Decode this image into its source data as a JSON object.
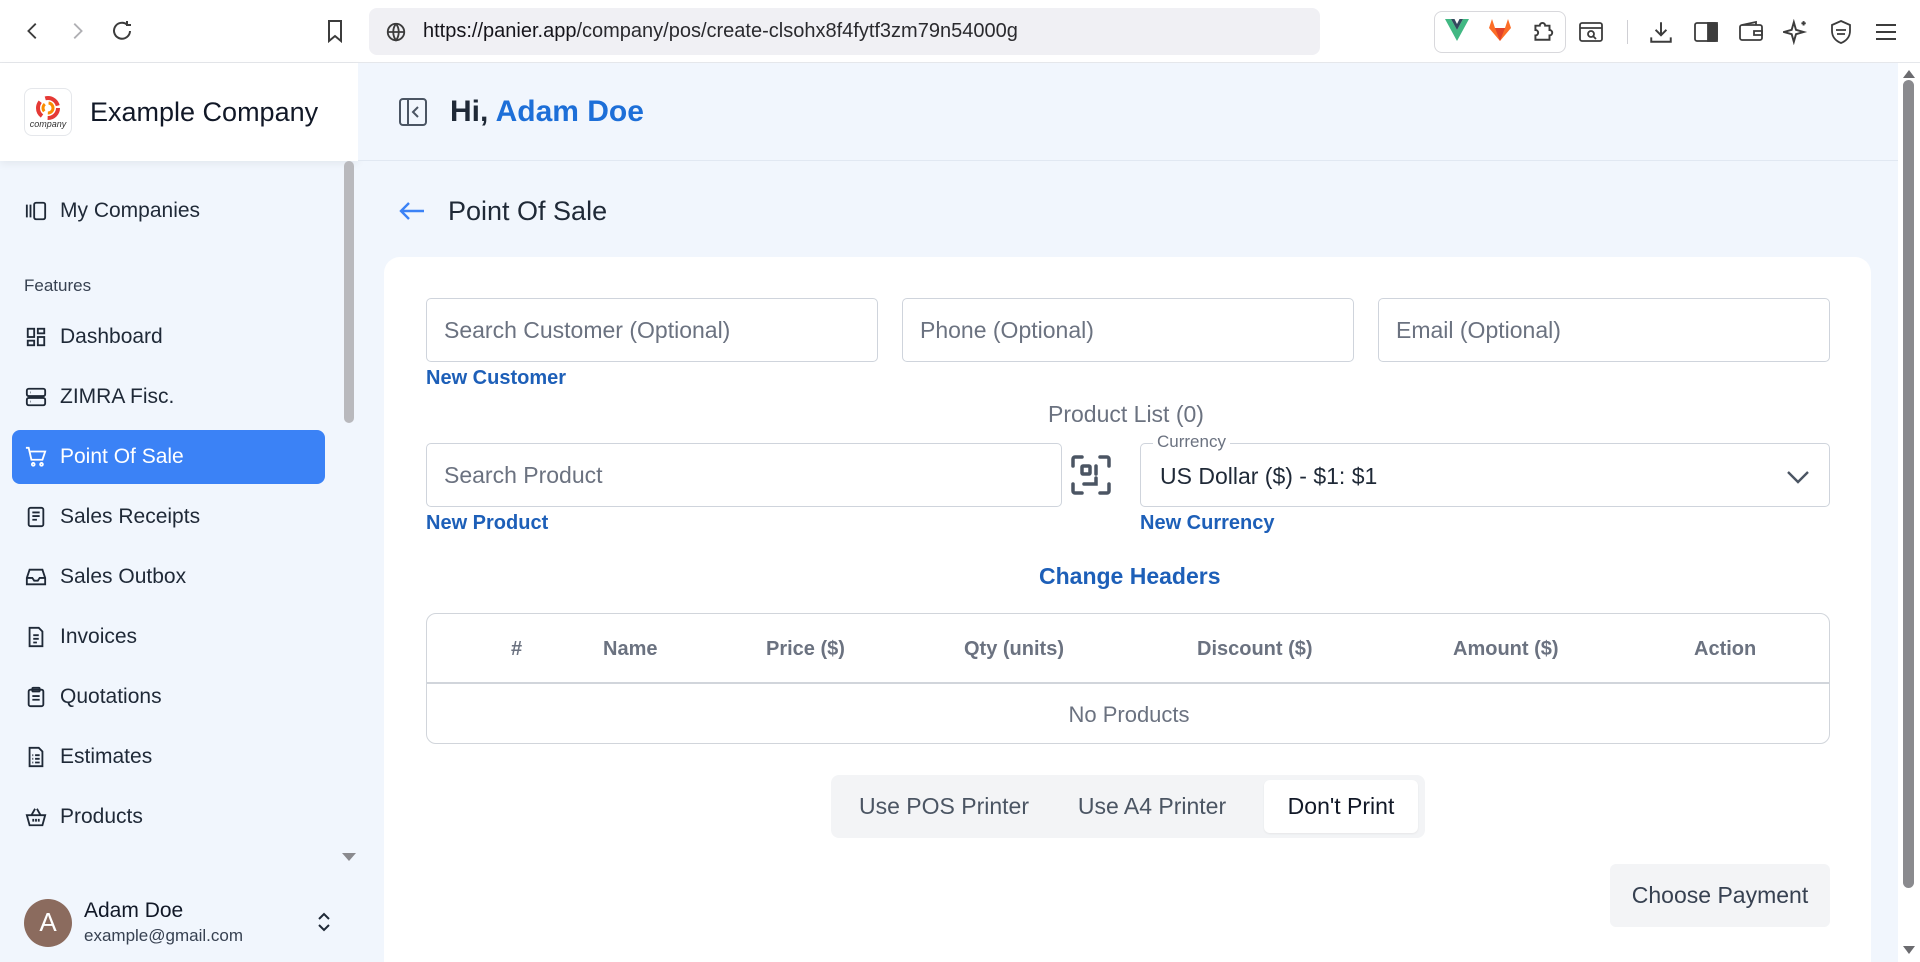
{
  "browser": {
    "url_host": "https://panier.app",
    "url_path": "/company/pos/create-clsohx8f4fytf3zm79n54000g",
    "icons": [
      "back-icon",
      "forward-icon",
      "reload-icon",
      "bookmark-icon",
      "site-info-icon",
      "vue-extension-icon",
      "gitlab-extension-icon",
      "extensions-puzzle-icon",
      "search-page-icon",
      "download-icon",
      "sidebar-icon",
      "wallet-icon",
      "sparkle-icon",
      "shield-icon",
      "menu-icon"
    ]
  },
  "brand": {
    "name": "Example Company",
    "logo_text": "company"
  },
  "sidebar": {
    "top_item": "My Companies",
    "section_label": "Features",
    "items": [
      {
        "label": "Dashboard",
        "icon": "dashboard-icon"
      },
      {
        "label": "ZIMRA Fisc.",
        "icon": "server-icon"
      },
      {
        "label": "Point Of Sale",
        "icon": "cart-icon",
        "active": true
      },
      {
        "label": "Sales Receipts",
        "icon": "receipt-icon"
      },
      {
        "label": "Sales Outbox",
        "icon": "inbox-icon"
      },
      {
        "label": "Invoices",
        "icon": "invoice-icon"
      },
      {
        "label": "Quotations",
        "icon": "clipboard-icon"
      },
      {
        "label": "Estimates",
        "icon": "list-doc-icon"
      },
      {
        "label": "Products",
        "icon": "basket-icon"
      }
    ]
  },
  "user": {
    "initial": "A",
    "name": "Adam Doe",
    "email": "example@gmail.com"
  },
  "header": {
    "greeting": "Hi,",
    "user_name": "Adam Doe"
  },
  "page": {
    "title": "Point Of Sale"
  },
  "form": {
    "customer_placeholder": "Search Customer (Optional)",
    "phone_placeholder": "Phone (Optional)",
    "email_placeholder": "Email (Optional)",
    "new_customer": "New Customer",
    "product_list_label": "Product List (0)",
    "product_placeholder": "Search Product",
    "new_product": "New Product",
    "currency_label": "Currency",
    "currency_value": "US Dollar ($) - $1: $1",
    "new_currency": "New Currency",
    "change_headers": "Change Headers"
  },
  "table": {
    "headers": [
      "#",
      "Name",
      "Price ($)",
      "Qty (units)",
      "Discount ($)",
      "Amount ($)",
      "Action"
    ],
    "empty_text": "No Products"
  },
  "print_options": [
    "Use POS Printer",
    "Use A4 Printer",
    "Don't Print"
  ],
  "print_selected": "Don't Print",
  "payment_button": "Choose Payment",
  "colors": {
    "accent": "#3b82f6",
    "link": "#1d5fb8",
    "username": "#1d6fd8"
  }
}
